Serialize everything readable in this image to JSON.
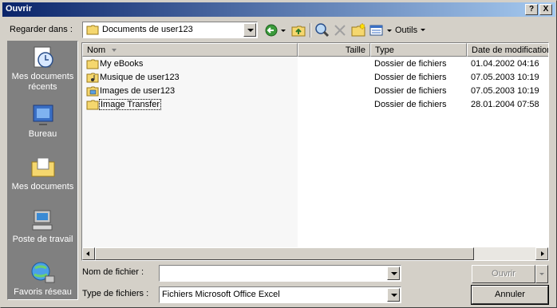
{
  "window": {
    "title": "Ouvrir"
  },
  "titlebar": {
    "help_label": "?",
    "close_label": "X"
  },
  "lookin": {
    "label": "Regarder dans :",
    "value": "Documents de user123"
  },
  "toolbar": {
    "tools_label": "Outils"
  },
  "places": [
    {
      "name": "place-recent",
      "label_line1": "Mes documents",
      "label_line2": "récents",
      "icon": "recent-documents-icon"
    },
    {
      "name": "place-desktop",
      "label_line1": "Bureau",
      "label_line2": "",
      "icon": "desktop-icon"
    },
    {
      "name": "place-mydocs",
      "label_line1": "Mes documents",
      "label_line2": "",
      "icon": "my-documents-icon"
    },
    {
      "name": "place-computer",
      "label_line1": "Poste de travail",
      "label_line2": "",
      "icon": "my-computer-icon"
    },
    {
      "name": "place-network",
      "label_line1": "Favoris réseau",
      "label_line2": "",
      "icon": "network-icon"
    }
  ],
  "columns": {
    "name": "Nom",
    "size": "Taille",
    "type": "Type",
    "date": "Date de modification"
  },
  "files": [
    {
      "name": "My eBooks",
      "size": "",
      "type": "Dossier de fichiers",
      "date": "01.04.2002 04:16",
      "icon": "folder-icon"
    },
    {
      "name": "Musique de user123",
      "size": "",
      "type": "Dossier de fichiers",
      "date": "07.05.2003 10:19",
      "icon": "music-folder-icon"
    },
    {
      "name": "Images de user123",
      "size": "",
      "type": "Dossier de fichiers",
      "date": "07.05.2003 10:19",
      "icon": "pictures-folder-icon"
    },
    {
      "name": "Image Transfer",
      "size": "",
      "type": "Dossier de fichiers",
      "date": "28.01.2004 07:58",
      "icon": "folder-icon"
    }
  ],
  "filename": {
    "label": "Nom de fichier :",
    "value": ""
  },
  "filetype": {
    "label": "Type de fichiers :",
    "value": "Fichiers Microsoft Office Excel"
  },
  "buttons": {
    "open": "Ouvrir",
    "cancel": "Annuler"
  }
}
